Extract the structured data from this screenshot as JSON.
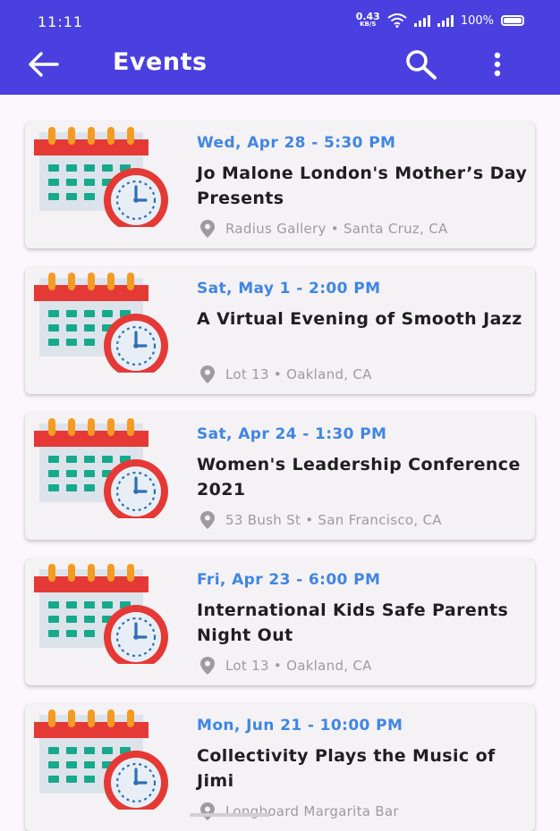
{
  "status_bar": {
    "time": "11:11",
    "net_speed_value": "0.43",
    "net_speed_unit": "KB/S",
    "battery_percent": "100%"
  },
  "app_bar": {
    "title": "Events",
    "back_icon": "arrow-left-icon",
    "search_icon": "search-icon",
    "more_icon": "more-vertical-icon"
  },
  "colors": {
    "app_bar": "#4A40E0",
    "date_text": "#3F86E4",
    "card_background": "#F5F2F6",
    "page_background": "#FCF7FC",
    "calendar_red": "#E53935",
    "calendar_teal": "#16A98C",
    "calendar_ring": "#F59A23"
  },
  "events": [
    {
      "date": "Wed, Apr 28 - 5:30 PM",
      "title": "Jo Malone London's Mother’s Day Presents",
      "location": "Radius Gallery • Santa Cruz, CA",
      "icon": "calendar-clock-icon"
    },
    {
      "date": "Sat, May 1 - 2:00 PM",
      "title": "A Virtual Evening of Smooth Jazz",
      "location": "Lot 13 • Oakland, CA",
      "icon": "calendar-clock-icon"
    },
    {
      "date": "Sat, Apr 24 - 1:30 PM",
      "title": "Women's Leadership Conference 2021",
      "location": "53 Bush St • San Francisco, CA",
      "icon": "calendar-clock-icon"
    },
    {
      "date": "Fri, Apr 23 - 6:00 PM",
      "title": "International Kids Safe Parents Night Out",
      "location": "Lot 13 • Oakland, CA",
      "icon": "calendar-clock-icon"
    },
    {
      "date": "Mon, Jun 21 - 10:00 PM",
      "title": "Collectivity Plays the Music of Jimi",
      "location": "Longboard Margarita Bar",
      "icon": "calendar-clock-icon"
    }
  ]
}
